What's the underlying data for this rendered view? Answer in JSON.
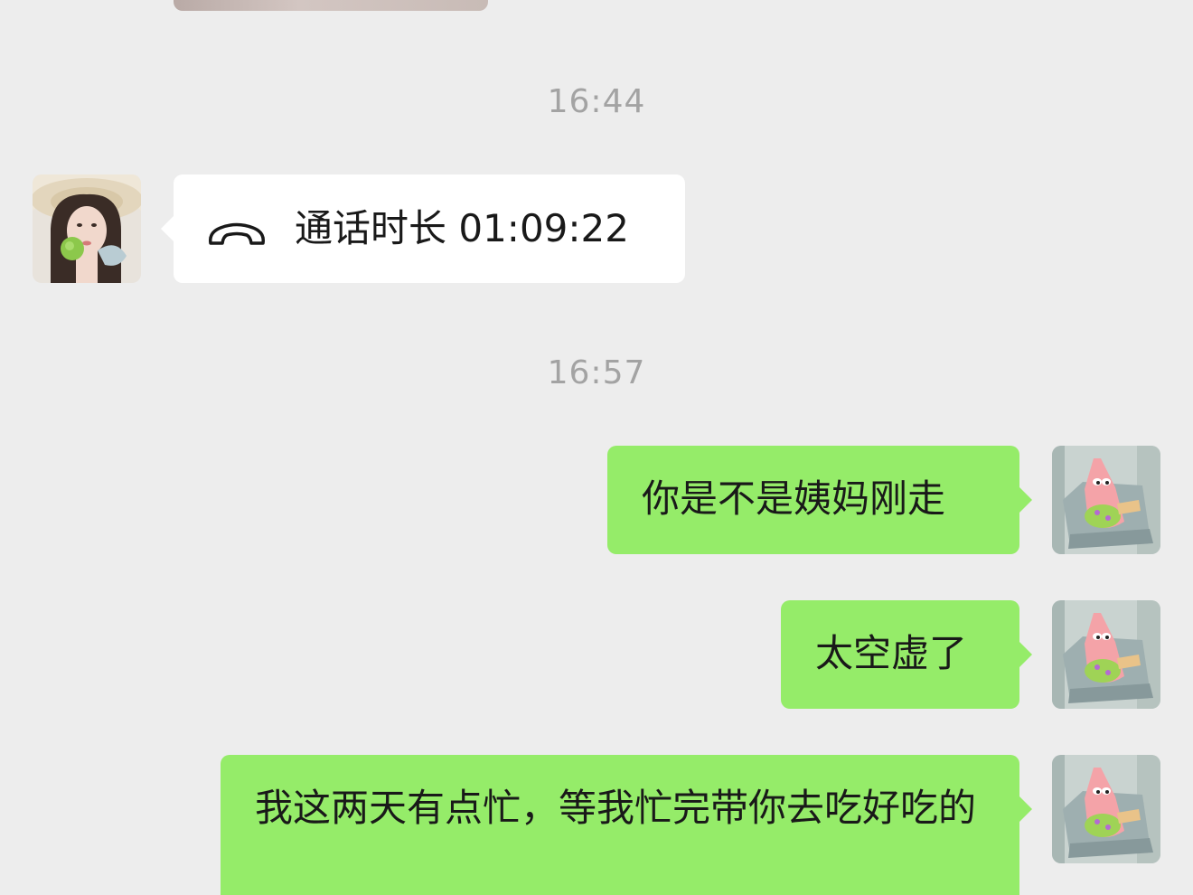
{
  "conversation": {
    "timestamps": [
      "16:44",
      "16:57"
    ],
    "call": {
      "label": "通话时长 01:09:22",
      "icon": "phone-hangup-icon"
    },
    "messages": [
      {
        "sender": "self",
        "text": "你是不是姨妈刚走"
      },
      {
        "sender": "self",
        "text": "太空虚了"
      },
      {
        "sender": "self",
        "text": "我这两天有点忙，等我忙完带你去吃好吃的"
      }
    ],
    "colors": {
      "background": "#ededed",
      "outgoing_bubble": "#95ec69",
      "incoming_bubble": "#ffffff",
      "timestamp": "#a3a3a3",
      "text": "#191919"
    }
  }
}
